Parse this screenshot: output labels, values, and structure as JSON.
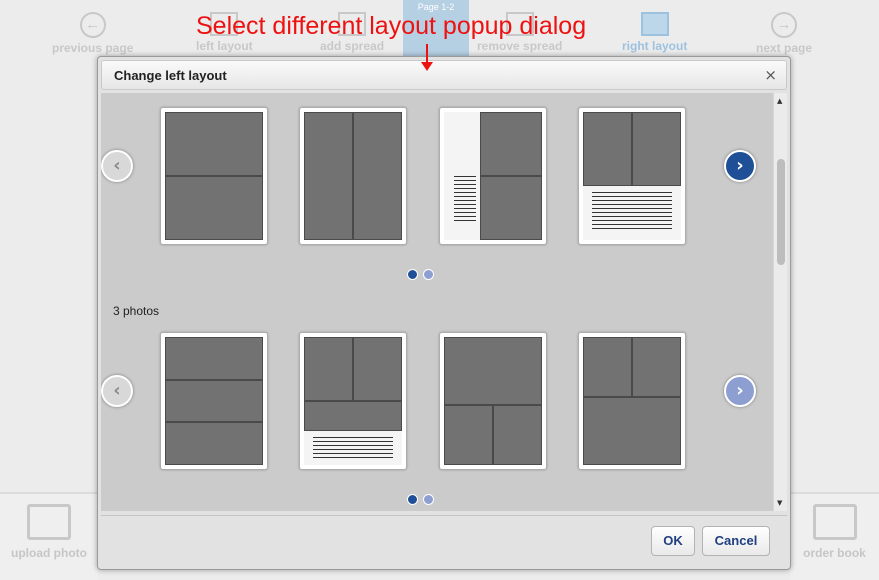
{
  "toolbar": {
    "previous_page": "previous page",
    "left_layout": "left layout",
    "add_spread": "add spread",
    "remove_spread": "remove spread",
    "right_layout": "right layout",
    "next_page": "next page",
    "page_badge": "Page\n1-2"
  },
  "bottom": {
    "upload_photo": "upload photo",
    "order_book": "order book"
  },
  "annotation": {
    "text": "Select different layout popup dialog",
    "color": "#ee1111"
  },
  "dialog": {
    "title": "Change left layout",
    "close_glyph": "×",
    "section_2_label": "3 photos",
    "ok_label": "OK",
    "cancel_label": "Cancel",
    "accent_color": "#1f4f96"
  },
  "icons": {
    "prev": "‹",
    "next": "›"
  }
}
